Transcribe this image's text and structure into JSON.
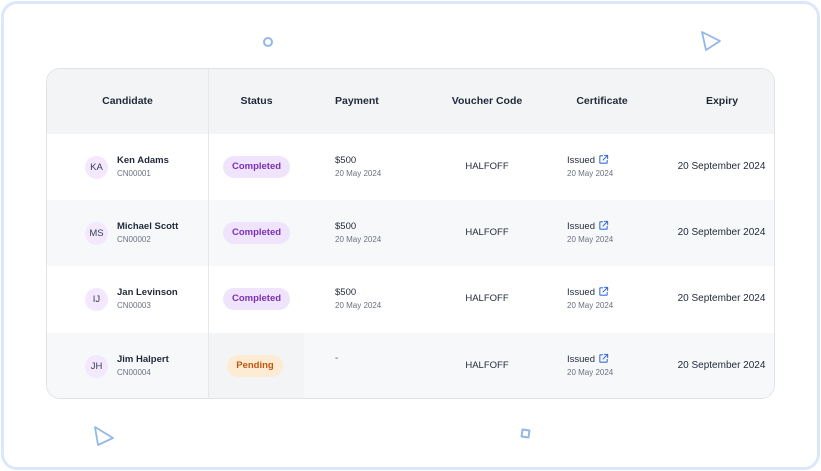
{
  "colors": {
    "frame_border": "#dbe8fb",
    "header_bg": "#f3f4f6",
    "completed_badge_bg": "#efe4fb",
    "completed_badge_text": "#7a2fb8",
    "pending_badge_bg": "#fdebd3",
    "pending_badge_text": "#c2560f",
    "avatar_bg": "#f3e8fd",
    "link_icon": "#3b6fd8",
    "decoration": "#93b8e8"
  },
  "decorations": [
    "circle-outline",
    "triangle-outline",
    "triangle-outline",
    "square-outline"
  ],
  "table": {
    "headers": {
      "candidate": "Candidate",
      "status": "Status",
      "payment": "Payment",
      "voucher": "Voucher Code",
      "certificate": "Certificate",
      "expiry": "Expiry"
    },
    "rows": [
      {
        "initials": "KA",
        "name": "Ken Adams",
        "id": "CN00001",
        "status": "Completed",
        "payment_amount": "$500",
        "payment_date": "20 May 2024",
        "voucher": "HALFOFF",
        "cert_status": "Issued",
        "cert_icon": "external-link-icon",
        "cert_date": "20 May 2024",
        "expiry": "20 September 2024"
      },
      {
        "initials": "MS",
        "name": "Michael Scott",
        "id": "CN00002",
        "status": "Completed",
        "payment_amount": "$500",
        "payment_date": "20 May 2024",
        "voucher": "HALFOFF",
        "cert_status": "Issued",
        "cert_icon": "external-link-icon",
        "cert_date": "20 May 2024",
        "expiry": "20 September 2024"
      },
      {
        "initials": "IJ",
        "name": "Jan Levinson",
        "id": "CN00003",
        "status": "Completed",
        "payment_amount": "$500",
        "payment_date": "20 May 2024",
        "voucher": "HALFOFF",
        "cert_status": "Issued",
        "cert_icon": "external-link-icon",
        "cert_date": "20 May 2024",
        "expiry": "20 September 2024"
      },
      {
        "initials": "JH",
        "name": "Jim Halpert",
        "id": "CN00004",
        "status": "Pending",
        "payment_amount": "-",
        "payment_date": "",
        "voucher": "HALFOFF",
        "cert_status": "Issued",
        "cert_icon": "external-link-icon",
        "cert_date": "20 May 2024",
        "expiry": "20 September 2024"
      }
    ]
  }
}
